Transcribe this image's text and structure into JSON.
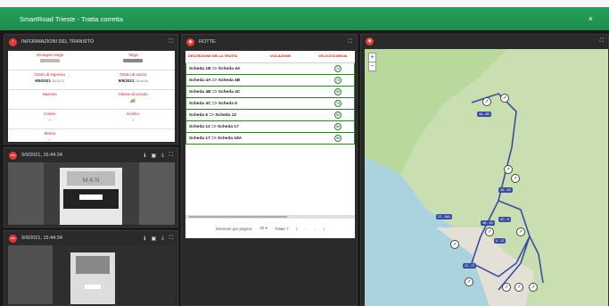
{
  "header": {
    "title": "SmartRoad Trieste - Tratta corretta",
    "close": "×"
  },
  "info": {
    "title": "INFORMAZIONI DEL TRANSITO",
    "badge": "i",
    "fields": [
      {
        "label": "Immagine targa",
        "value": "",
        "type": "plate"
      },
      {
        "label": "Targa",
        "value": "",
        "type": "plate2"
      },
      {
        "label": "Orario di ingresso",
        "value": "9/9/2021",
        "sub": "15:22:07"
      },
      {
        "label": "Orario di uscita",
        "value": "9/9/2021",
        "sub": "15:44:34"
      },
      {
        "label": "Nazione",
        "value": ""
      },
      {
        "label": "Classe di veicolo",
        "value": "",
        "type": "truck"
      },
      {
        "label": "Colore",
        "value": "-"
      },
      {
        "label": "Kemler",
        "value": "-"
      },
      {
        "label": "Marca",
        "value": "-"
      }
    ]
  },
  "cameras": [
    {
      "badge": "USC",
      "time": "9/9/2021, 15:44:34"
    },
    {
      "badge": "ING",
      "time": "9/9/2021, 15:44:34"
    }
  ],
  "rotte": {
    "title": "ROTTE",
    "columns": [
      "DESCRIZIONE DELLA TRATTA",
      "VIOLAZIONE",
      "VELOCITÀ MEDIA"
    ],
    "rows": [
      {
        "desc": "Scheda 1B => Scheda 4A",
        "speed": "72"
      },
      {
        "desc": "Scheda 4A => Scheda 4B",
        "speed": "70"
      },
      {
        "desc": "Scheda 4B => Scheda 4C",
        "speed": "50"
      },
      {
        "desc": "Scheda 4C => Scheda 6",
        "speed": "70"
      },
      {
        "desc": "Scheda 6 => Scheda 12",
        "speed": "50"
      },
      {
        "desc": "Scheda 12 => Scheda 17",
        "speed": "50"
      },
      {
        "desc": "Scheda 17 => Scheda 18A",
        "speed": "50"
      }
    ],
    "pager": {
      "label": "Elementi per pagina:",
      "per_page": "20",
      "total": "Totale 7"
    }
  },
  "map": {
    "zoom_in": "+",
    "zoom_out": "−",
    "tags": [
      "4A - 4B",
      "4A - 4B",
      "4B - 4C",
      "4C - 6",
      "12 - 18A",
      "6 - 12",
      "12 - 17"
    ]
  }
}
